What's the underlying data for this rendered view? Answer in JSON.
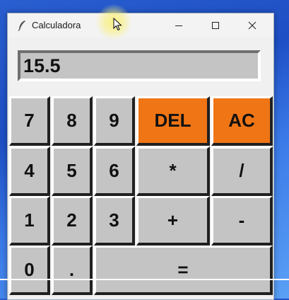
{
  "window": {
    "title": "Calculadora",
    "icon": "feather-icon",
    "controls": {
      "minimize": "minimize-icon",
      "maximize": "maximize-icon",
      "close": "close-icon"
    }
  },
  "display": {
    "value": "15.5"
  },
  "keys": {
    "k7": "7",
    "k8": "8",
    "k9": "9",
    "del": "DEL",
    "ac": "AC",
    "k4": "4",
    "k5": "5",
    "k6": "6",
    "mul": "*",
    "div": "/",
    "k1": "1",
    "k2": "2",
    "k3": "3",
    "add": "+",
    "sub": "-",
    "k0": "0",
    "dot": ".",
    "eq": "="
  },
  "colors": {
    "key_bg": "#c4c4c4",
    "accent": "#f07515"
  }
}
